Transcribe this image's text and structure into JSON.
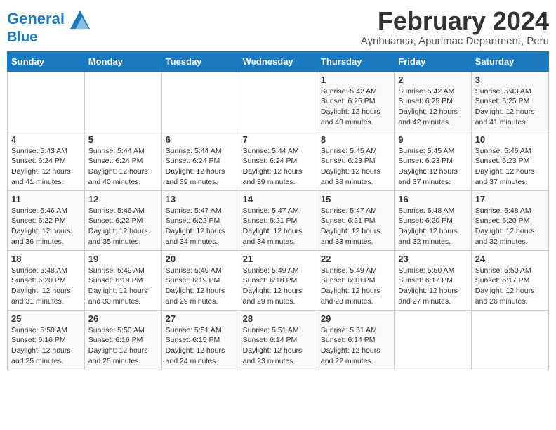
{
  "header": {
    "logo_line1": "General",
    "logo_line2": "Blue",
    "main_title": "February 2024",
    "subtitle": "Ayrihuanca, Apurimac Department, Peru"
  },
  "days_of_week": [
    "Sunday",
    "Monday",
    "Tuesday",
    "Wednesday",
    "Thursday",
    "Friday",
    "Saturday"
  ],
  "weeks": [
    [
      {
        "day": "",
        "info": ""
      },
      {
        "day": "",
        "info": ""
      },
      {
        "day": "",
        "info": ""
      },
      {
        "day": "",
        "info": ""
      },
      {
        "day": "1",
        "info": "Sunrise: 5:42 AM\nSunset: 6:25 PM\nDaylight: 12 hours\nand 43 minutes."
      },
      {
        "day": "2",
        "info": "Sunrise: 5:42 AM\nSunset: 6:25 PM\nDaylight: 12 hours\nand 42 minutes."
      },
      {
        "day": "3",
        "info": "Sunrise: 5:43 AM\nSunset: 6:25 PM\nDaylight: 12 hours\nand 41 minutes."
      }
    ],
    [
      {
        "day": "4",
        "info": "Sunrise: 5:43 AM\nSunset: 6:24 PM\nDaylight: 12 hours\nand 41 minutes."
      },
      {
        "day": "5",
        "info": "Sunrise: 5:44 AM\nSunset: 6:24 PM\nDaylight: 12 hours\nand 40 minutes."
      },
      {
        "day": "6",
        "info": "Sunrise: 5:44 AM\nSunset: 6:24 PM\nDaylight: 12 hours\nand 39 minutes."
      },
      {
        "day": "7",
        "info": "Sunrise: 5:44 AM\nSunset: 6:24 PM\nDaylight: 12 hours\nand 39 minutes."
      },
      {
        "day": "8",
        "info": "Sunrise: 5:45 AM\nSunset: 6:23 PM\nDaylight: 12 hours\nand 38 minutes."
      },
      {
        "day": "9",
        "info": "Sunrise: 5:45 AM\nSunset: 6:23 PM\nDaylight: 12 hours\nand 37 minutes."
      },
      {
        "day": "10",
        "info": "Sunrise: 5:46 AM\nSunset: 6:23 PM\nDaylight: 12 hours\nand 37 minutes."
      }
    ],
    [
      {
        "day": "11",
        "info": "Sunrise: 5:46 AM\nSunset: 6:22 PM\nDaylight: 12 hours\nand 36 minutes."
      },
      {
        "day": "12",
        "info": "Sunrise: 5:46 AM\nSunset: 6:22 PM\nDaylight: 12 hours\nand 35 minutes."
      },
      {
        "day": "13",
        "info": "Sunrise: 5:47 AM\nSunset: 6:22 PM\nDaylight: 12 hours\nand 34 minutes."
      },
      {
        "day": "14",
        "info": "Sunrise: 5:47 AM\nSunset: 6:21 PM\nDaylight: 12 hours\nand 34 minutes."
      },
      {
        "day": "15",
        "info": "Sunrise: 5:47 AM\nSunset: 6:21 PM\nDaylight: 12 hours\nand 33 minutes."
      },
      {
        "day": "16",
        "info": "Sunrise: 5:48 AM\nSunset: 6:20 PM\nDaylight: 12 hours\nand 32 minutes."
      },
      {
        "day": "17",
        "info": "Sunrise: 5:48 AM\nSunset: 6:20 PM\nDaylight: 12 hours\nand 32 minutes."
      }
    ],
    [
      {
        "day": "18",
        "info": "Sunrise: 5:48 AM\nSunset: 6:20 PM\nDaylight: 12 hours\nand 31 minutes."
      },
      {
        "day": "19",
        "info": "Sunrise: 5:49 AM\nSunset: 6:19 PM\nDaylight: 12 hours\nand 30 minutes."
      },
      {
        "day": "20",
        "info": "Sunrise: 5:49 AM\nSunset: 6:19 PM\nDaylight: 12 hours\nand 29 minutes."
      },
      {
        "day": "21",
        "info": "Sunrise: 5:49 AM\nSunset: 6:18 PM\nDaylight: 12 hours\nand 29 minutes."
      },
      {
        "day": "22",
        "info": "Sunrise: 5:49 AM\nSunset: 6:18 PM\nDaylight: 12 hours\nand 28 minutes."
      },
      {
        "day": "23",
        "info": "Sunrise: 5:50 AM\nSunset: 6:17 PM\nDaylight: 12 hours\nand 27 minutes."
      },
      {
        "day": "24",
        "info": "Sunrise: 5:50 AM\nSunset: 6:17 PM\nDaylight: 12 hours\nand 26 minutes."
      }
    ],
    [
      {
        "day": "25",
        "info": "Sunrise: 5:50 AM\nSunset: 6:16 PM\nDaylight: 12 hours\nand 25 minutes."
      },
      {
        "day": "26",
        "info": "Sunrise: 5:50 AM\nSunset: 6:16 PM\nDaylight: 12 hours\nand 25 minutes."
      },
      {
        "day": "27",
        "info": "Sunrise: 5:51 AM\nSunset: 6:15 PM\nDaylight: 12 hours\nand 24 minutes."
      },
      {
        "day": "28",
        "info": "Sunrise: 5:51 AM\nSunset: 6:14 PM\nDaylight: 12 hours\nand 23 minutes."
      },
      {
        "day": "29",
        "info": "Sunrise: 5:51 AM\nSunset: 6:14 PM\nDaylight: 12 hours\nand 22 minutes."
      },
      {
        "day": "",
        "info": ""
      },
      {
        "day": "",
        "info": ""
      }
    ]
  ]
}
